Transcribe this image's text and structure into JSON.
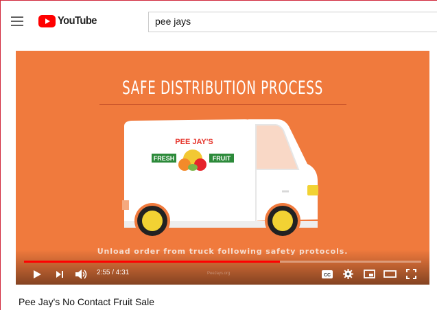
{
  "app": {
    "logo_text": "YouTube"
  },
  "search": {
    "value": "pee jays"
  },
  "video": {
    "title_card": "SAFE DISTRIBUTION PROCESS",
    "caption": "Unload order from truck following safety protocols.",
    "truck_logo": {
      "top_text": "PEE JAY'S",
      "left_text": "FRESH",
      "right_text": "FRUIT"
    },
    "watermark": "PeeJays.org",
    "colors": {
      "background": "#f07a3d",
      "progress": "#ff0000"
    }
  },
  "player": {
    "current_time": "2:55",
    "duration": "4:31",
    "time_display": "2:55 / 4:31",
    "progress_fraction": 0.645,
    "cc_label": "CC",
    "icons": [
      "play-icon",
      "next-icon",
      "volume-icon",
      "cc-icon",
      "settings-icon",
      "miniplayer-icon",
      "theater-icon",
      "fullscreen-icon"
    ]
  },
  "page": {
    "video_title": "Pee Jay's No Contact Fruit Sale"
  }
}
